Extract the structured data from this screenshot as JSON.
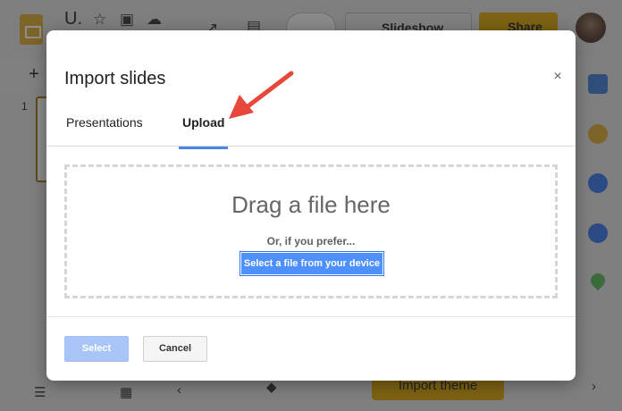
{
  "app": {
    "doc_title": "U.",
    "slideshow_label": "Slideshow",
    "share_label": "Share",
    "add_label": "+",
    "slide_number": "1",
    "import_theme_label": "Import theme"
  },
  "dialog": {
    "title": "Import slides",
    "close_label": "×",
    "tabs": [
      {
        "label": "Presentations",
        "active": false
      },
      {
        "label": "Upload",
        "active": true
      }
    ],
    "dropzone": {
      "heading": "Drag a file here",
      "subtext": "Or, if you prefer...",
      "select_file_label": "Select a file from your device"
    },
    "footer": {
      "select_label": "Select",
      "cancel_label": "Cancel"
    }
  },
  "annotation": {
    "arrow_color": "#e8483c"
  },
  "colors": {
    "accent": "#4a86e8",
    "primary_button": "#4d90fe",
    "disabled_button": "#a9c4f7",
    "overlay": "#808080",
    "share_button": "#7c6213"
  },
  "icons": {
    "side_panel": [
      "calendar-icon",
      "keep-icon",
      "tasks-icon",
      "contacts-icon",
      "maps-icon"
    ]
  }
}
